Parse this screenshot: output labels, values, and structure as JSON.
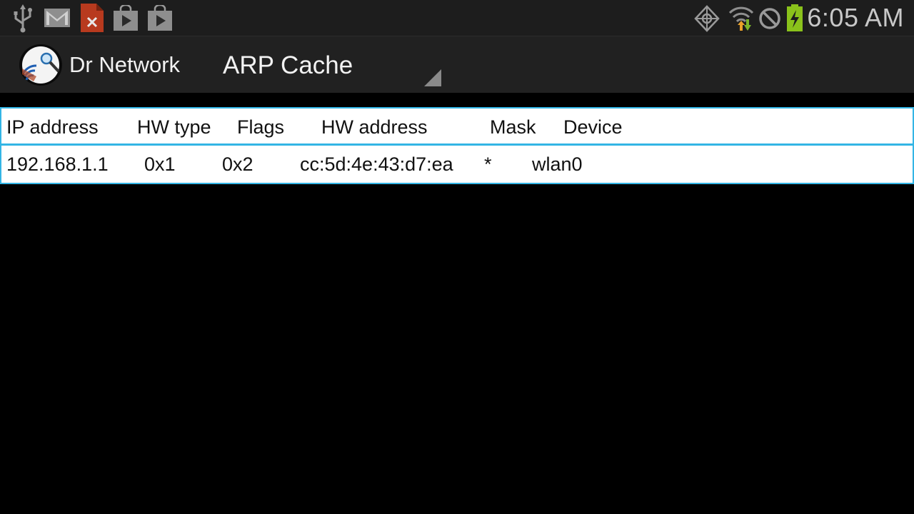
{
  "status_bar": {
    "clock": "6:05 AM",
    "left_icons": [
      "usb-icon",
      "gmail-icon",
      "file-error-icon",
      "play-store-icon",
      "play-store-icon"
    ],
    "right_icons": [
      "gps-icon",
      "wifi-icon",
      "block-icon",
      "battery-charging-icon"
    ]
  },
  "action_bar": {
    "app_name": "Dr Network",
    "spinner_label": "ARP Cache"
  },
  "arp_table": {
    "columns": [
      "IP address",
      "HW type",
      "Flags",
      "HW address",
      "Mask",
      "Device"
    ],
    "rows": [
      [
        "192.168.1.1",
        "0x1",
        "0x2",
        "cc:5d:4e:43:d7:ea",
        "*",
        "wlan0"
      ]
    ]
  },
  "colors": {
    "accent": "#33b5e5",
    "status_bar": "#1d1d1d",
    "action_bar": "#212121",
    "battery": "#8ac21b"
  }
}
